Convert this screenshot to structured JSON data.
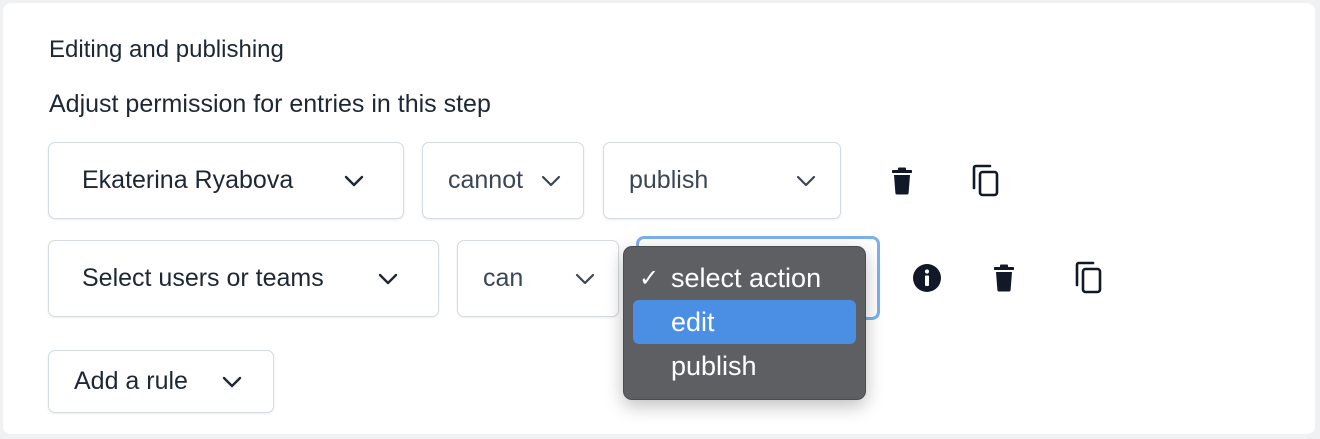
{
  "section": {
    "title": "Editing and publishing",
    "description": "Adjust permission for entries in this step"
  },
  "rules": [
    {
      "subject": "Ekaterina Ryabova",
      "permission": "cannot",
      "action": "publish"
    },
    {
      "subject": "Select users or teams",
      "permission": "can",
      "action": "select action"
    }
  ],
  "action_dropdown": {
    "options": [
      {
        "label": "select action",
        "checked": true,
        "highlighted": false
      },
      {
        "label": "edit",
        "checked": false,
        "highlighted": true
      },
      {
        "label": "publish",
        "checked": false,
        "highlighted": false
      }
    ]
  },
  "add_rule": {
    "label": "Add a rule"
  },
  "icons": {
    "delete": "trash-icon",
    "duplicate": "copy-icon",
    "info": "info-icon",
    "chevron": "chevron-down-icon",
    "check": "✓"
  },
  "colors": {
    "menu_background": "#5e5f63",
    "menu_highlight": "#4a8fe4",
    "focus_ring": "#7bb0ec",
    "border": "#d3dce0",
    "text": "#1d2735"
  }
}
